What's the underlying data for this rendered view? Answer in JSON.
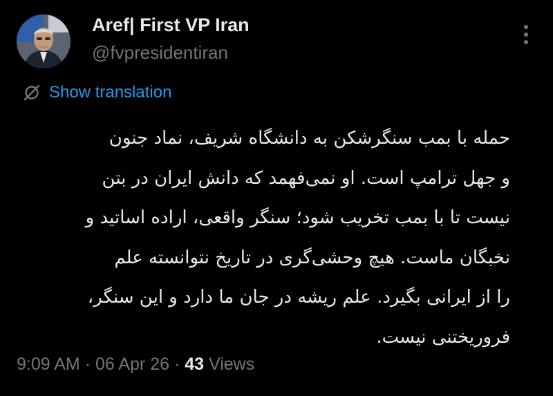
{
  "author": {
    "display_name": "Aref| First VP Iran",
    "handle": "@fvpresidentiran",
    "avatar_icon": "profile-photo-avatar"
  },
  "more_icon": "more-vertical-icon",
  "translation": {
    "icon": "translate-icon",
    "label": "Show translation"
  },
  "post": {
    "lines": [
      "حمله با بمب سنگرشکن به دانشگاه شریف، نماد جنون",
      "و جهل ترامپ است. او نمی‌فهمد که دانش ایران در بتن",
      "نیست تا با بمب تخریب شود؛ سنگر واقعی، اراده اساتید و",
      "نخبگان ماست. هیچ وحشی‌گری  در تاریخ نتوانسته علم",
      "را از ایرانی بگیرد. علم ریشه در جان ما دارد و این سنگر،",
      "فروریختنی نیست."
    ]
  },
  "meta": {
    "time": "9:09 AM",
    "separator": "·",
    "date": "06 Apr 26",
    "views_count": "43",
    "views_label": "Views"
  },
  "colors": {
    "background": "#000000",
    "primary_text": "#e7e9ea",
    "secondary_text": "#71767b",
    "accent": "#1d9bf0"
  }
}
